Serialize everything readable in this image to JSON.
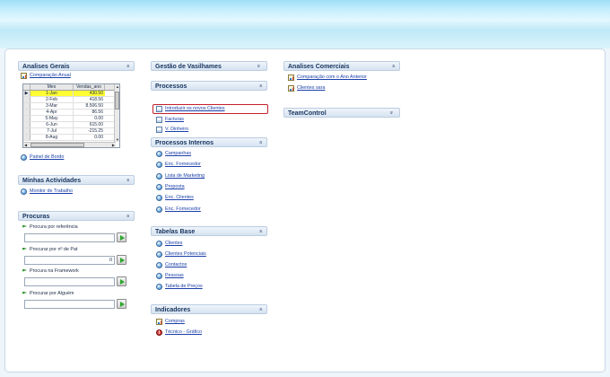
{
  "colors": {
    "accent": "#15335e",
    "link": "#1a3fa8",
    "selected_row": "#ffff33",
    "highlight_border": "#c4202a",
    "go_arrow": "#2da82d"
  },
  "analises_gerais": {
    "title": "Analises Gerais",
    "link": "Comparação Anual",
    "grid_headers": {
      "mes": "Mes",
      "vendas": "Vendas_ano"
    },
    "rows": [
      {
        "mes": "1-Jan",
        "valor": "430.50",
        "selected": true
      },
      {
        "mes": "2-Feb",
        "valor": "418.56"
      },
      {
        "mes": "3-Mar",
        "valor": "8.506.50"
      },
      {
        "mes": "4-Apr",
        "valor": "86.56"
      },
      {
        "mes": "5-May",
        "valor": "0.00"
      },
      {
        "mes": "6-Jun",
        "valor": "615.00"
      },
      {
        "mes": "7-Jul",
        "valor": "-215.25"
      },
      {
        "mes": "8-Aug",
        "valor": "0.00"
      }
    ],
    "painel_link": "Painel de Bordo"
  },
  "minhas_actividades": {
    "title": "Minhas Actividades",
    "link": "Monitor de Trabalho"
  },
  "procuras": {
    "title": "Procuras",
    "items": [
      {
        "label": "Procura por referência",
        "value": ""
      },
      {
        "label": "Procurar por nº de Pat",
        "value": "0"
      },
      {
        "label": "Procura na Framework",
        "value": ""
      },
      {
        "label": "Procurar por Alguém",
        "value": ""
      }
    ]
  },
  "gestao_vasilhames": {
    "title": "Gestão de Vasilhames"
  },
  "processos": {
    "title": "Processos",
    "items": [
      "Introduzir os novos Clientes",
      "Facturas",
      "V. Dinheiro"
    ]
  },
  "processos_internos": {
    "title": "Processos Internos",
    "items": [
      "Campanhas",
      "Enc. Fornecedor",
      "Lista de Marketing",
      "Proposta",
      "Enc. Clientes",
      "Enc. Fornecedor"
    ]
  },
  "tabelas_base": {
    "title": "Tabelas Base",
    "items": [
      "Clientes",
      "Clientes Potenciais",
      "Contactos",
      "Pessoas",
      "Tabela de Preços"
    ]
  },
  "indicadores": {
    "title": "Indicadores",
    "items": [
      {
        "label": "Compras",
        "icon": "bar-chart-icon"
      },
      {
        "label": "Técnico - Gráfico",
        "icon": "alert-icon"
      }
    ]
  },
  "analises_comerciais": {
    "title": "Analises Comerciais",
    "items": [
      "Comparação com o Ano Anterior",
      "Clientes sara"
    ]
  },
  "teamcontrol": {
    "title": "TeamControl"
  }
}
